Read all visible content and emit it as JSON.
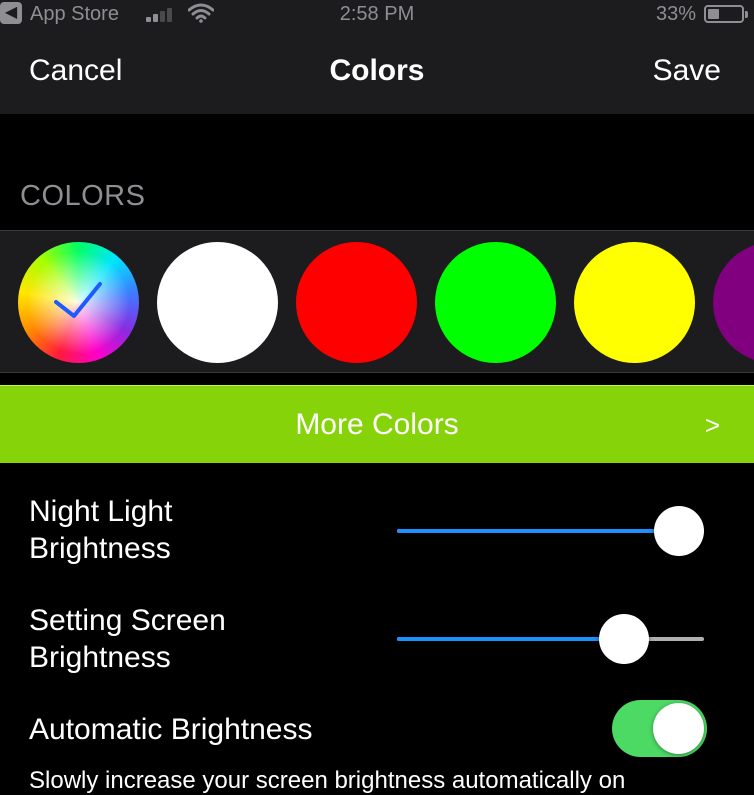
{
  "status_bar": {
    "back_glyph": "◀",
    "back_app": "App Store",
    "time": "2:58 PM",
    "battery": "33%",
    "battery_level": 0.33
  },
  "nav": {
    "cancel_label": "Cancel",
    "title": "Colors",
    "save_label": "Save"
  },
  "colors_section": {
    "header": "COLORS",
    "swatches": [
      {
        "name": "color-wheel",
        "color": "conic",
        "selected": true
      },
      {
        "name": "white",
        "color": "#ffffff",
        "selected": false
      },
      {
        "name": "red",
        "color": "#ff0000",
        "selected": false
      },
      {
        "name": "green",
        "color": "#00ff00",
        "selected": false
      },
      {
        "name": "yellow",
        "color": "#ffff00",
        "selected": false
      },
      {
        "name": "purple",
        "color": "#800080",
        "selected": false
      }
    ]
  },
  "more_colors": {
    "label": "More Colors",
    "chevron": ">",
    "color": "#86d30a"
  },
  "settings": {
    "night_light": {
      "label_line1": "Night Light",
      "label_line2": "Brightness",
      "value": 0.92
    },
    "screen_brightness": {
      "label_line1": "Setting Screen",
      "label_line2": "Brightness",
      "value": 0.74
    },
    "auto_brightness": {
      "label": "Automatic Brightness",
      "enabled": true
    },
    "description": "Slowly increase your screen brightness automatically on"
  },
  "colors": {
    "accent_blue": "#1e8fff",
    "toggle_green": "#4cd964",
    "background": "#000000",
    "bar": "#1c1c1e"
  }
}
